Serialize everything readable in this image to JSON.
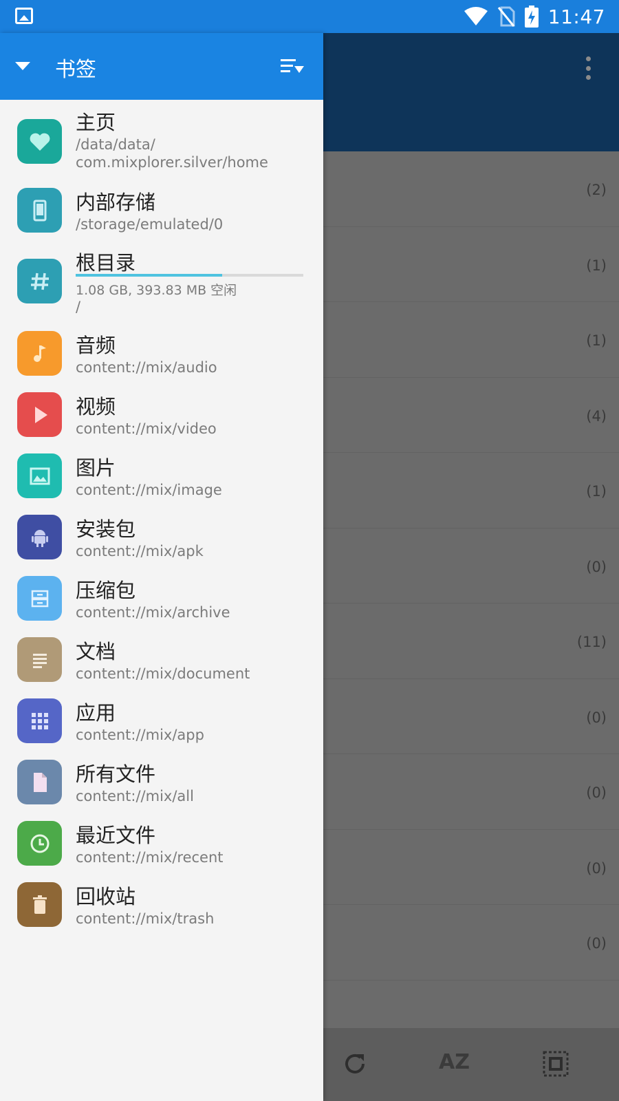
{
  "status_bar": {
    "time": "11:47",
    "icons": [
      "image-icon",
      "wifi-icon",
      "no-sim-icon",
      "battery-charging-icon"
    ]
  },
  "drawer": {
    "title": "书签",
    "items": [
      {
        "title": "主页",
        "sub": "/data/data/",
        "sub2": "com.mixplorer.silver/home",
        "icon": "heart-icon",
        "color": "#1aa89a"
      },
      {
        "title": "内部存储",
        "sub": "/storage/emulated/0",
        "icon": "phone-icon",
        "color": "#2d9fb3"
      },
      {
        "title": "根目录",
        "sub": "1.08 GB,  393.83 MB 空闲",
        "sub2": "/",
        "icon": "hash-icon",
        "color": "#2d9fb3",
        "usage_fraction": 0.645
      },
      {
        "title": "音频",
        "sub": "content://mix/audio",
        "icon": "music-icon",
        "color": "#f79a2c"
      },
      {
        "title": "视频",
        "sub": "content://mix/video",
        "icon": "play-icon",
        "color": "#e54d4d"
      },
      {
        "title": "图片",
        "sub": "content://mix/image",
        "icon": "image-icon",
        "color": "#1fbcb0"
      },
      {
        "title": "安装包",
        "sub": "content://mix/apk",
        "icon": "android-icon",
        "color": "#3f4ea3"
      },
      {
        "title": "压缩包",
        "sub": "content://mix/archive",
        "icon": "archive-icon",
        "color": "#5cb2ef"
      },
      {
        "title": "文档",
        "sub": "content://mix/document",
        "icon": "document-icon",
        "color": "#b09a77"
      },
      {
        "title": "应用",
        "sub": "content://mix/app",
        "icon": "grid-icon",
        "color": "#5566c7"
      },
      {
        "title": "所有文件",
        "sub": "content://mix/all",
        "icon": "file-icon",
        "color": "#6b88ab"
      },
      {
        "title": "最近文件",
        "sub": "content://mix/recent",
        "icon": "clock-icon",
        "color": "#4caa49"
      },
      {
        "title": "回收站",
        "sub": "content://mix/trash",
        "icon": "trash-icon",
        "color": "#8e6736"
      }
    ]
  },
  "background": {
    "counts": [
      "(2)",
      "(1)",
      "(1)",
      "(4)",
      "(1)",
      "(0)",
      "(11)",
      "(0)",
      "(0)",
      "(0)",
      "(0)"
    ],
    "sort_label": "AZ"
  }
}
